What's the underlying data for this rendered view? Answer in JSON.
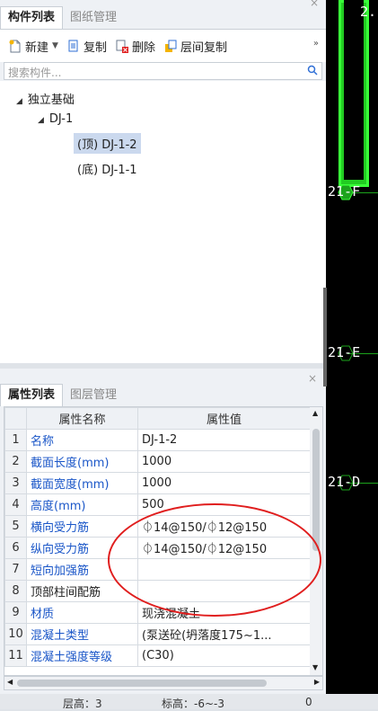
{
  "top_panel": {
    "tabs": [
      {
        "label": "构件列表",
        "active": true
      },
      {
        "label": "图纸管理",
        "active": false
      }
    ],
    "close": "×",
    "toolbar": {
      "new": "新建",
      "copy": "复制",
      "delete": "删除",
      "floor_copy": "层间复制",
      "more": "»"
    },
    "search_placeholder": "搜索构件..."
  },
  "tree": {
    "root": "独立基础",
    "child": "DJ-1",
    "leaf_top": "(顶) DJ-1-2",
    "leaf_bottom": "(底) DJ-1-1"
  },
  "bottom_panel": {
    "close": "×",
    "tabs": [
      {
        "label": "属性列表",
        "active": true
      },
      {
        "label": "图层管理",
        "active": false
      }
    ],
    "headers": {
      "name": "属性名称",
      "value": "属性值"
    },
    "rows": [
      {
        "n": "1",
        "name": "名称",
        "value": "DJ-1-2",
        "blue": true
      },
      {
        "n": "2",
        "name": "截面长度(mm)",
        "value": "1000",
        "blue": true
      },
      {
        "n": "3",
        "name": "截面宽度(mm)",
        "value": "1000",
        "blue": true
      },
      {
        "n": "4",
        "name": "高度(mm)",
        "value": "500",
        "blue": true
      },
      {
        "n": "5",
        "name": "横向受力筋",
        "value": "⏀14@150/⏀12@150",
        "blue": true
      },
      {
        "n": "6",
        "name": "纵向受力筋",
        "value": "⏀14@150/⏀12@150",
        "blue": true
      },
      {
        "n": "7",
        "name": "短向加强筋",
        "value": "",
        "blue": true
      },
      {
        "n": "8",
        "name": "顶部柱间配筋",
        "value": "",
        "blue": false
      },
      {
        "n": "9",
        "name": "材质",
        "value": "现浇混凝土",
        "blue": true
      },
      {
        "n": "10",
        "name": "混凝土类型",
        "value": "(泵送砼(坍落度175~1...",
        "blue": true
      },
      {
        "n": "11",
        "name": "混凝土强度等级",
        "value": "(C30)",
        "blue": true
      }
    ]
  },
  "status": {
    "floor": "层高：3",
    "elev": "标高：-6~-3",
    "extra": "0"
  },
  "canvas": {
    "labels": {
      "top": "2.",
      "f": "21-F",
      "e": "21-E",
      "d": "21-D"
    },
    "colors": {
      "green": "#22cc22",
      "line": "#1ca31c",
      "annotation": "#e01e1e"
    }
  }
}
